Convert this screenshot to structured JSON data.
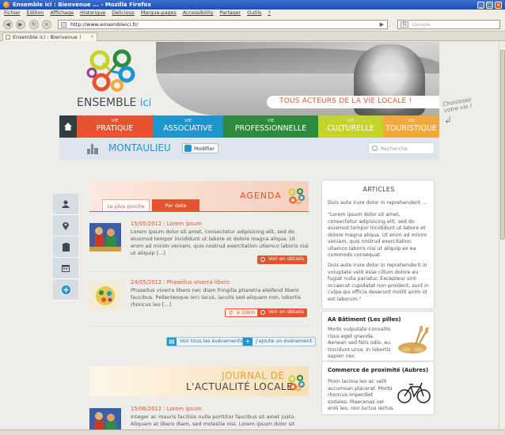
{
  "browser": {
    "window_title": "Ensemble ici : Bienvenue ... - Mozilla Firefox",
    "menu": [
      "Fichier",
      "Édition",
      "Affichage",
      "Historique",
      "Delicious",
      "Marque-pages",
      "Accessibility",
      "Partager",
      "Outils",
      "?"
    ],
    "url": "http://www.ensembleici.fr/",
    "search_placeholder": "Google",
    "tab_title": "Ensemble ici : Bienvenue !"
  },
  "site": {
    "logo_main": "ENSEMBLE",
    "logo_ici": "ici",
    "tagline": "TOUS ACTEURS DE LA VIE LOCALE !",
    "side_note": "Choisissez votre vie !",
    "colors": {
      "orange": "#e5542f",
      "blue": "#1e95cf",
      "dark": "#343b43"
    }
  },
  "nav": {
    "categories": [
      {
        "small": "VIE",
        "label": "PRATIQUE",
        "color": "#e5542f"
      },
      {
        "small": "VIE",
        "label": "ASSOCIATIVE",
        "color": "#1e95cf"
      },
      {
        "small": "VIE",
        "label": "PROFESSIONNELLE",
        "color": "#2e8b3d"
      },
      {
        "small": "VIE",
        "label": "CULTURELLE",
        "color": "#c5d42b"
      },
      {
        "small": "VIE",
        "label": "TOURISTIQUE",
        "color": "#f0a93a"
      }
    ]
  },
  "location": {
    "town": "MONTAULIEU",
    "modify_label": "Modifier",
    "search_placeholder": "Recherche"
  },
  "agenda": {
    "title": "AGENDA",
    "tab_near": "Le plus proche",
    "tab_date": "Par date",
    "events": [
      {
        "date_title": "15/05/2012 : Lorem ipsum",
        "text": "Lorem ipsum dolor sit amet, consectetur adipisicing elit, sed do eiusmod tempor incididunt ut labore et dolore magna aliqua. Ut enim ad minim veniam, quis nostrud exercitation ullamco laboris nisi ut aliquip [...]",
        "details": "Voir en détails"
      },
      {
        "date_title": "24/05/2012 : Phasellus viverra libero",
        "text": "Phasellus viverra libero nec diam fringilla pharetra eleifend libero faucibus. Pellentesque orci lacus, iaculis sed aliquam non, lobortis rhoncus leo [...]",
        "distance": "à 10km",
        "details": "Voir en détails"
      }
    ],
    "see_all": "Voir tous les événements",
    "add_event": "J'ajoute un événement"
  },
  "journal": {
    "title_line1": "JOURNAL DE",
    "title_line2": "L'ACTUALITÉ LOCALE",
    "item": {
      "date_title": "15/06/2012 : Lorem ipsum",
      "text": "Integer ac mauris facilisis nulla porttitor faucibus sit amet justo. Aliquam at libero diam, sed molestie nisi. Lorem ipsum dolor sit amet, consectetur"
    }
  },
  "articles": {
    "title": "ARTICLES",
    "intro": "Duis aute irure dolor in reprehendent ...",
    "quote": "\"Lorem ipsum dolor sit amet, consectetur adipisicing elit, sed do eiusmod tempor incididunt ut labore et dolore magna aliqua. Ut enim ad minim veniam, quis nostrud exercitation ullamco laboris nisi ut aliquip ex ea commodo consequat.",
    "body": "Duis aute irure dolor in reprehenderit in voluptate velit esse cillum dolore eu fugiat nulla pariatur. Excepteur sint occaecat cupidatat non proident, sunt in culpa qui officia deserunt mollit anim id est laborum.\""
  },
  "ads": [
    {
      "title": "AA Bâtiment (Les pilles)",
      "text": "Morbi vulputate convallis risus eget gravida. Aenean sed felis odio, eu tincidunt urna. In lobortis sapien nec."
    },
    {
      "title": "Commerce de proximité (Aubres)",
      "text": "Proin lacinia leo ac velit accumsan placerat. Morbi rhoncus imperdiet sodales. Maecenas vel eros leo, non luctus lectus."
    }
  ]
}
